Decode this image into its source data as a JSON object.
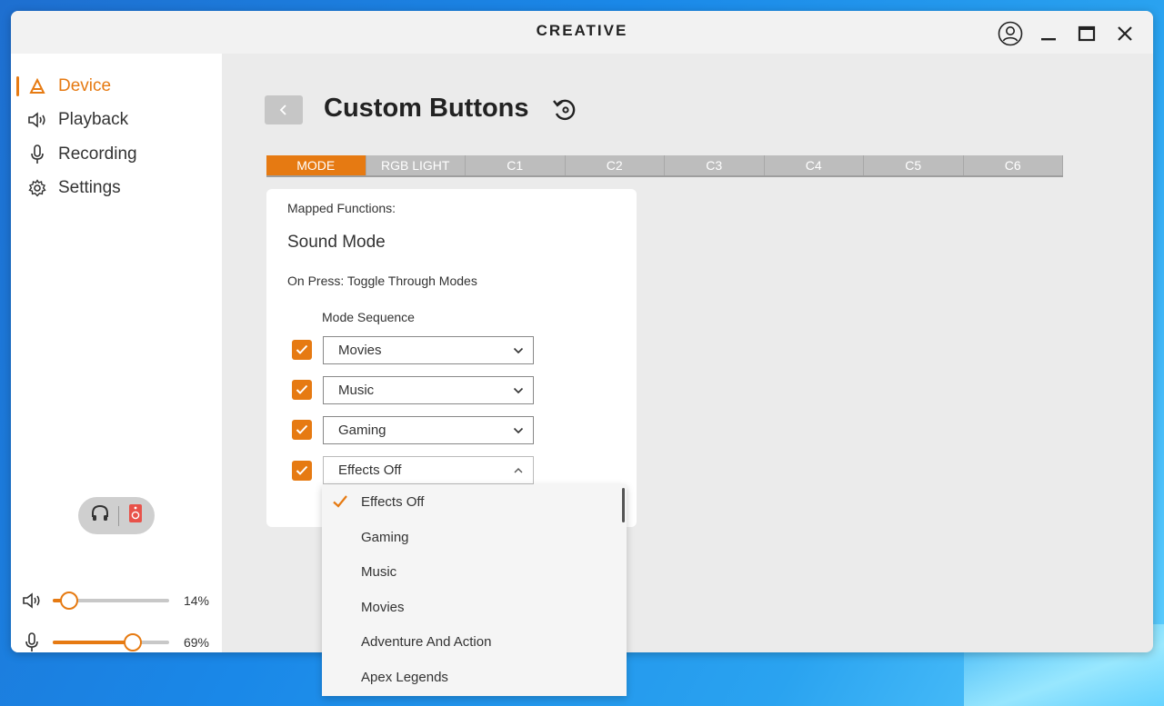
{
  "app": {
    "brand": "CREATIVE"
  },
  "sidebar": {
    "items": [
      {
        "label": "Device",
        "icon": "device-icon",
        "active": true
      },
      {
        "label": "Playback",
        "icon": "speaker-icon"
      },
      {
        "label": "Recording",
        "icon": "microphone-icon"
      },
      {
        "label": "Settings",
        "icon": "gear-icon"
      }
    ],
    "output": {
      "left_icon": "headphones-icon",
      "right_icon": "speaker-device-icon"
    },
    "volume": {
      "playback_label": "14%",
      "playback_level": 0.14,
      "mic_label": "69%",
      "mic_level": 0.69
    }
  },
  "page": {
    "title": "Custom Buttons",
    "tabs": [
      "MODE",
      "RGB LIGHT",
      "C1",
      "C2",
      "C3",
      "C4",
      "C5",
      "C6"
    ],
    "active_tab": 0
  },
  "card": {
    "mapped_label": "Mapped Functions:",
    "function": "Sound Mode",
    "on_press": "On Press: Toggle Through Modes",
    "sequence_label": "Mode Sequence",
    "sequence": [
      "Movies",
      "Music",
      "Gaming",
      "Effects Off"
    ]
  },
  "dropdown": {
    "items": [
      "Effects Off",
      "Gaming",
      "Music",
      "Movies",
      "Adventure And Action",
      "Apex Legends"
    ],
    "selected": "Effects Off"
  },
  "colors": {
    "accent": "#e67a12",
    "tab_inactive": "#bdbdbd"
  }
}
